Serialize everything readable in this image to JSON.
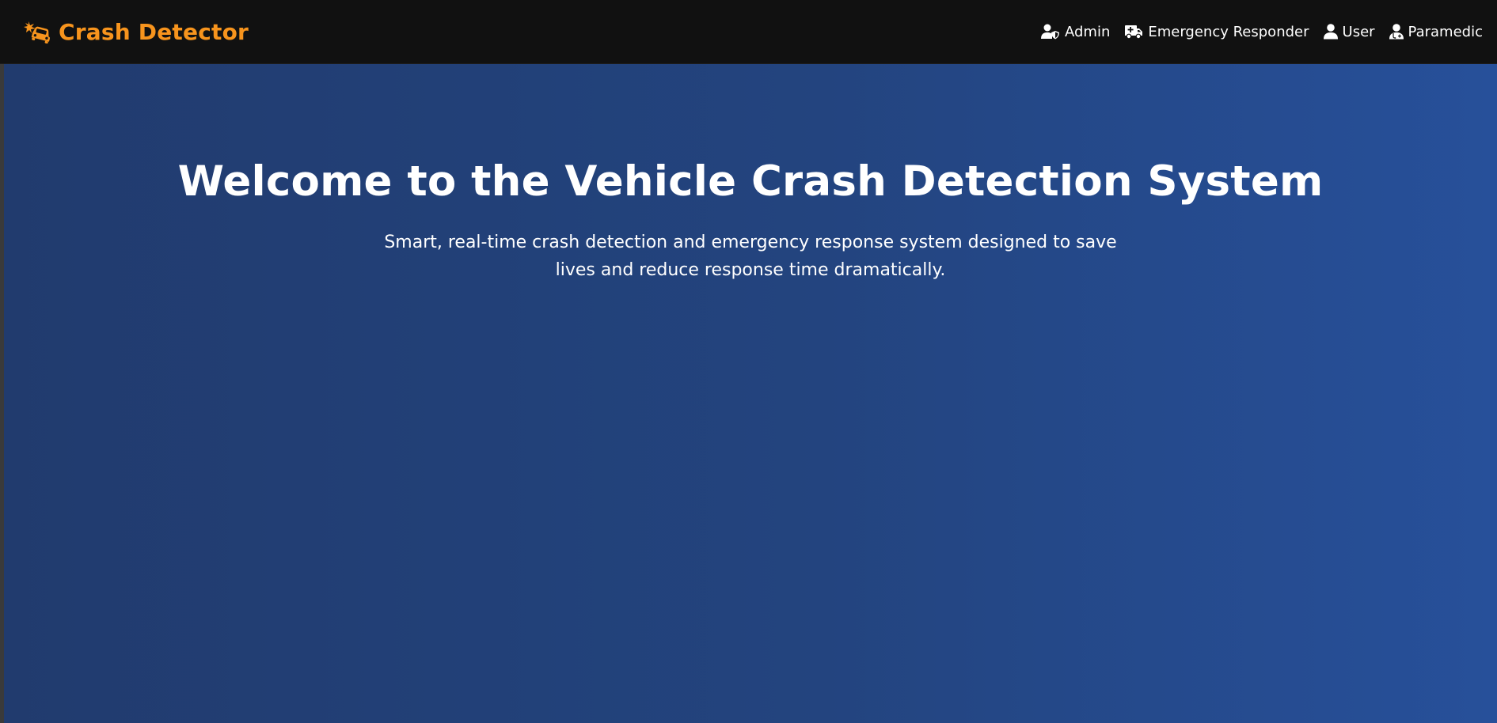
{
  "app": {
    "brand_name": "Crash Detector",
    "brand_icon": "car-crash-icon",
    "brand_color": "#f7941d"
  },
  "nav": {
    "items": [
      {
        "label": "Admin",
        "icon": "user-shield-icon"
      },
      {
        "label": "Emergency Responder",
        "icon": "ambulance-icon"
      },
      {
        "label": "User",
        "icon": "user-icon"
      },
      {
        "label": "Paramedic",
        "icon": "user-doctor-icon"
      }
    ]
  },
  "hero": {
    "title": "Welcome to the Vehicle Crash Detection System",
    "subtitle": "Smart, real-time crash detection and emergency response system designed to save lives and reduce response time dramatically.",
    "gradient_start": "#213b6e",
    "gradient_end": "#27509a"
  },
  "colors": {
    "navbar_bg": "#111111",
    "text": "#ffffff"
  }
}
